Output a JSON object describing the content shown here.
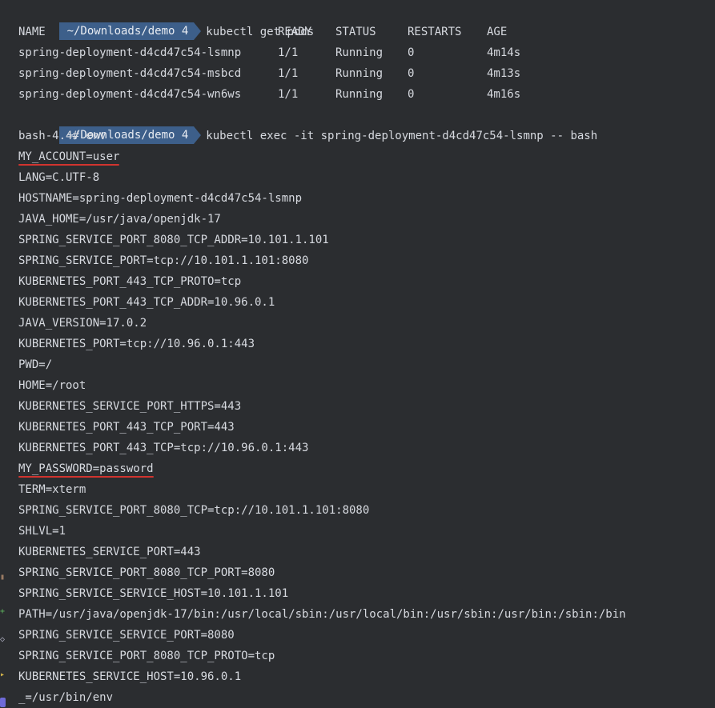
{
  "prompt": {
    "path": "~/Downloads/demo 4",
    "color": "#3d5f8a"
  },
  "commands": {
    "get_pods": "kubectl get pods",
    "exec": "kubectl exec -it spring-deployment-d4cd47c54-lsmnp -- bash"
  },
  "pods_table": {
    "headers": [
      "NAME",
      "READY",
      "STATUS",
      "RESTARTS",
      "AGE"
    ],
    "rows": [
      [
        "spring-deployment-d4cd47c54-lsmnp",
        "1/1",
        "Running",
        "0",
        "4m14s"
      ],
      [
        "spring-deployment-d4cd47c54-msbcd",
        "1/1",
        "Running",
        "0",
        "4m13s"
      ],
      [
        "spring-deployment-d4cd47c54-wn6ws",
        "1/1",
        "Running",
        "0",
        "4m16s"
      ]
    ]
  },
  "bash_prompt": "bash-4.4# env",
  "env_lines": [
    "MY_ACCOUNT=user",
    "LANG=C.UTF-8",
    "HOSTNAME=spring-deployment-d4cd47c54-lsmnp",
    "JAVA_HOME=/usr/java/openjdk-17",
    "SPRING_SERVICE_PORT_8080_TCP_ADDR=10.101.1.101",
    "SPRING_SERVICE_PORT=tcp://10.101.1.101:8080",
    "KUBERNETES_PORT_443_TCP_PROTO=tcp",
    "KUBERNETES_PORT_443_TCP_ADDR=10.96.0.1",
    "JAVA_VERSION=17.0.2",
    "KUBERNETES_PORT=tcp://10.96.0.1:443",
    "PWD=/",
    "HOME=/root",
    "KUBERNETES_SERVICE_PORT_HTTPS=443",
    "KUBERNETES_PORT_443_TCP_PORT=443",
    "KUBERNETES_PORT_443_TCP=tcp://10.96.0.1:443",
    "MY_PASSWORD=password",
    "TERM=xterm",
    "SPRING_SERVICE_PORT_8080_TCP=tcp://10.101.1.101:8080",
    "SHLVL=1",
    "KUBERNETES_SERVICE_PORT=443",
    "SPRING_SERVICE_PORT_8080_TCP_PORT=8080",
    "SPRING_SERVICE_SERVICE_HOST=10.101.1.101",
    "PATH=/usr/java/openjdk-17/bin:/usr/local/sbin:/usr/local/bin:/usr/sbin:/usr/bin:/sbin:/bin",
    "SPRING_SERVICE_SERVICE_PORT=8080",
    "SPRING_SERVICE_PORT_8080_TCP_PROTO=tcp",
    "KUBERNETES_SERVICE_HOST=10.96.0.1",
    "_=/usr/bin/env"
  ],
  "highlight_color": "#d1342f",
  "gutter_icons": [
    "terminal-tab-icon",
    "green-plus-icon",
    "git-icon",
    "arrow-icon",
    "plugin-icon"
  ]
}
